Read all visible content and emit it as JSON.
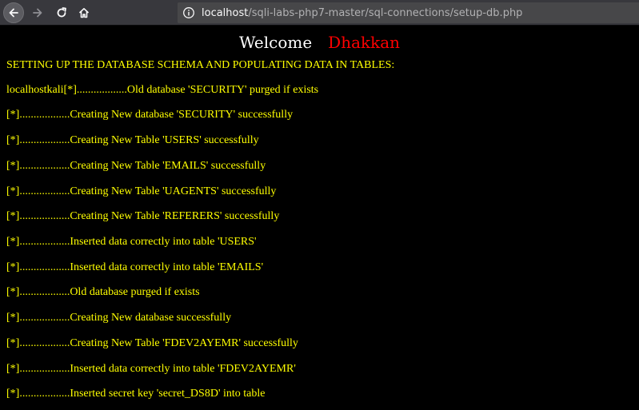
{
  "browser": {
    "url_host": "localhost",
    "url_path": "/sqli-labs-php7-master/sql-connections/setup-db.php"
  },
  "header": {
    "welcome": "Welcome",
    "name": "Dhakkan"
  },
  "heading": "SETTING UP THE DATABASE SCHEMA AND POPULATING DATA IN TABLES:",
  "log_lines": [
    "localhostkali[*]..................Old database 'SECURITY' purged if exists",
    "[*]..................Creating New database 'SECURITY' successfully",
    "[*]..................Creating New Table 'USERS' successfully",
    "[*]..................Creating New Table 'EMAILS' successfully",
    "[*]..................Creating New Table 'UAGENTS' successfully",
    "[*]..................Creating New Table 'REFERERS' successfully",
    "[*]..................Inserted data correctly into table 'USERS'",
    "[*]..................Inserted data correctly into table 'EMAILS'",
    "[*]..................Old database purged if exists",
    "[*]..................Creating New database successfully",
    "[*]..................Creating New Table 'FDEV2AYEMR' successfully",
    "[*]..................Inserted data correctly into table 'FDEV2AYEMR'",
    "[*]..................Inserted secret key 'secret_DS8D' into table"
  ],
  "icons": {
    "back": "arrow-left-icon",
    "forward": "arrow-right-icon",
    "reload": "reload-icon",
    "home": "home-icon",
    "info": "info-circle-icon"
  },
  "colors": {
    "page_background": "#000000",
    "log_text": "#ffff00",
    "welcome_text": "#ffffff",
    "name_text": "#ff0000"
  }
}
